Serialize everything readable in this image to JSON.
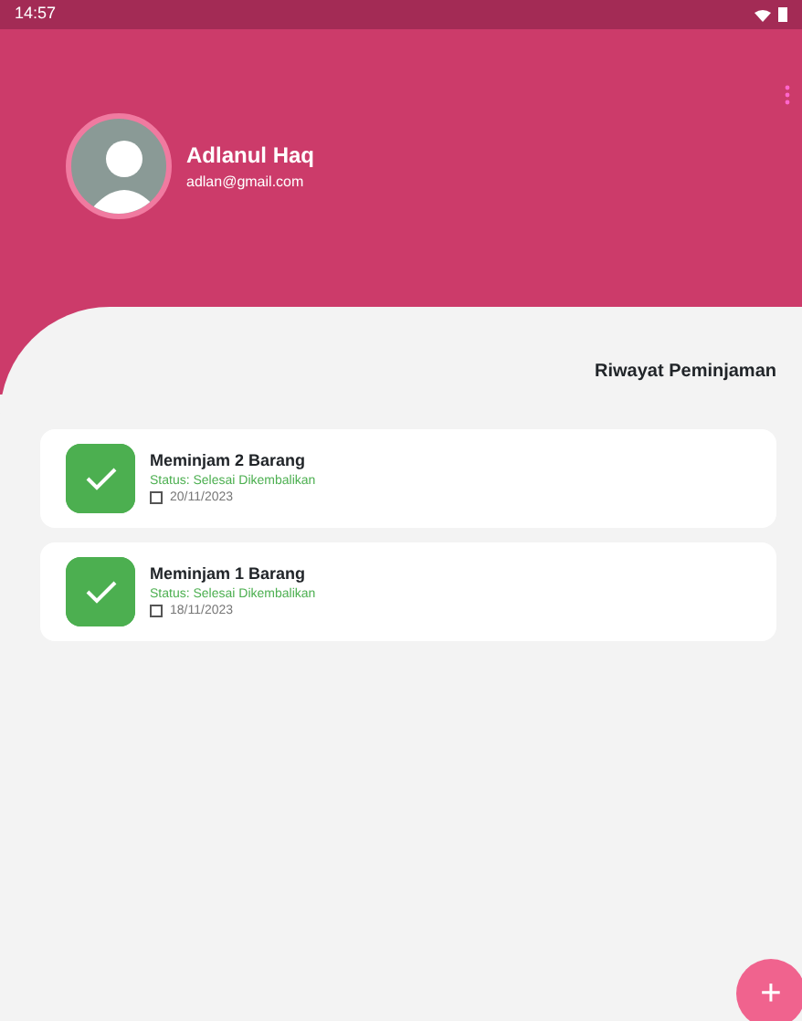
{
  "status_bar": {
    "time": "14:57"
  },
  "profile": {
    "name": "Adlanul Haq",
    "email": "adlan@gmail.com"
  },
  "section_title": "Riwayat Peminjaman",
  "loans": [
    {
      "title": "Meminjam 2 Barang",
      "status": "Status: Selesai Dikembalikan",
      "date": "20/11/2023"
    },
    {
      "title": "Meminjam 1 Barang",
      "status": "Status: Selesai Dikembalikan",
      "date": "18/11/2023"
    }
  ],
  "fab": {
    "label": "+"
  }
}
